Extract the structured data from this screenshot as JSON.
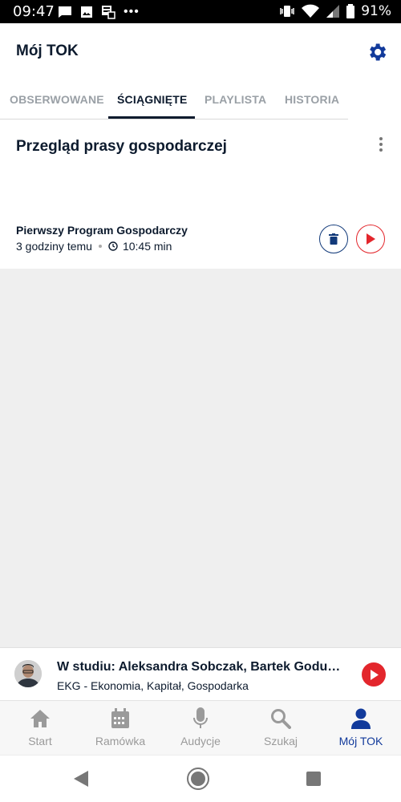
{
  "statusbar": {
    "time": "09:47",
    "battery": "91%"
  },
  "header": {
    "title": "Mój TOK"
  },
  "tabs": [
    {
      "label": "OBSERWOWANE"
    },
    {
      "label": "ŚCIĄGNIĘTE"
    },
    {
      "label": "PLAYLISTA"
    },
    {
      "label": "HISTORIA"
    }
  ],
  "episode": {
    "title": "Przegląd prasy gospodarczej",
    "program": "Pierwszy Program Gospodarczy",
    "ago": "3 godziny temu",
    "duration": "10:45 min"
  },
  "player": {
    "title": "W studiu: Aleksandra Sobczak, Bartek Godusławski",
    "subtitle": "EKG - Ekonomia, Kapitał, Gospodarka"
  },
  "bottomnav": [
    {
      "label": "Start",
      "icon": "home-icon"
    },
    {
      "label": "Ramówka",
      "icon": "calendar-icon"
    },
    {
      "label": "Audycje",
      "icon": "microphone-icon"
    },
    {
      "label": "Szukaj",
      "icon": "search-icon"
    },
    {
      "label": "Mój TOK",
      "icon": "user-icon"
    }
  ],
  "colors": {
    "accent": "#123a9b",
    "red": "#e3262c",
    "navy": "#0d1b2e"
  }
}
